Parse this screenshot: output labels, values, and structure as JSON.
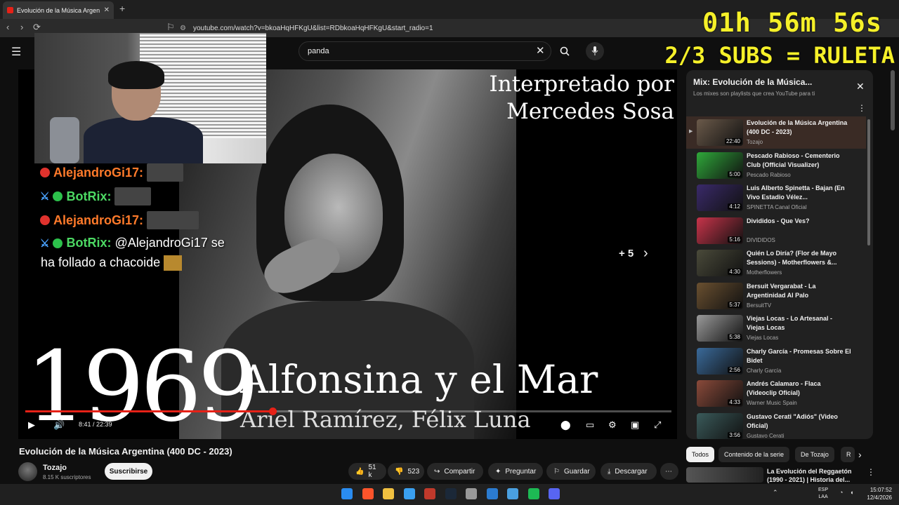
{
  "browser": {
    "tab_title": "Evolución de la Música Argen",
    "tab_close": "✕",
    "new_tab": "+",
    "url": "youtube.com/watch?v=bkoaHqHFKgU&list=RDbkoaHqHFKgU&start_radio=1"
  },
  "overlay": {
    "timer": "01h 56m 56s",
    "subs_text": "2/3 SUBS = RULETA"
  },
  "search": {
    "query": "panda",
    "clear": "✕"
  },
  "player": {
    "caption_line1": "Interpretado por",
    "caption_line2": "Mercedes Sosa",
    "year": "1969",
    "song_title": "Alfonsina y el Mar",
    "song_authors": "Ariel Ramírez, Félix Luna",
    "more_count": "+ 5",
    "timecode": "8:41 / 22:39",
    "progress_fraction": 0.383
  },
  "chat": [
    {
      "user": "AlejandroGi17:",
      "msg": ""
    },
    {
      "user": "BotRix:",
      "msg": ""
    },
    {
      "user": "AlejandroGi17:",
      "msg": ""
    },
    {
      "user": "BotRix:",
      "msg": "@AlejandroGi17 se"
    }
  ],
  "chat_continuation": "ha follado a chacoide",
  "video": {
    "title": "Evolución de la Música Argentina (400 DC - 2023)",
    "channel": "Tozajo",
    "subscribers": "8.15 K suscriptores",
    "subscribe": "Suscribirse",
    "likes": "51 k",
    "dislikes": "523",
    "share": "Compartir",
    "ask": "Preguntar",
    "save": "Guardar",
    "download": "Descargar"
  },
  "playlist": {
    "title": "Mix: Evolución de la Música...",
    "subtitle": "Los mixes son playlists que crea YouTube para ti",
    "items": [
      {
        "title": "Evolución de la Música Argentina (400 DC - 2023)",
        "channel": "Tozajo",
        "duration": "22:40",
        "color": "#6b5a4a"
      },
      {
        "title": "Pescado Rabioso - Cementerio Club (Official Visualizer)",
        "channel": "Pescado Rabioso",
        "duration": "5:00",
        "color": "#2fa83a"
      },
      {
        "title": "Luis Alberto Spinetta - Bajan (En Vivo Estadio Vélez...",
        "channel": "SPINETTA Canal Oficial",
        "duration": "4:12",
        "color": "#3a2a6a"
      },
      {
        "title": "Divididos - Que Ves?",
        "channel": "DIVIDIDOS",
        "duration": "5:16",
        "color": "#c8344a"
      },
      {
        "title": "Quién Lo Diría? (Flor de Mayo Sessions) - Motherflowers &...",
        "channel": "Motherflowers",
        "duration": "4:30",
        "color": "#4a4a3a"
      },
      {
        "title": "Bersuit Vergarabat - La Argentinidad Al Palo",
        "channel": "BersuitTV",
        "duration": "5:37",
        "color": "#6a5030"
      },
      {
        "title": "Viejas Locas - Lo Artesanal - Viejas Locas",
        "channel": "Viejas Locas",
        "duration": "5:38",
        "color": "#9a9a9a"
      },
      {
        "title": "Charly García - Promesas Sobre El Bidet",
        "channel": "Charly García",
        "duration": "2:56",
        "color": "#3a6a9a"
      },
      {
        "title": "Andrés Calamaro - Flaca (Videoclip Oficial)",
        "channel": "Warner Music Spain",
        "duration": "4:33",
        "color": "#8a4a3a"
      },
      {
        "title": "Gustavo Cerati \"Adiós\" (Video Oficial)",
        "channel": "Gustavo Cerati",
        "duration": "3:56",
        "color": "#3a5a5a"
      }
    ]
  },
  "chips": [
    "Todos",
    "Contenido de la serie",
    "De Tozajo",
    "R"
  ],
  "recommendation": {
    "title": "La Evolución del Reggaetón (1990 - 2021) | Historia del..."
  },
  "taskbar": {
    "lang1": "ESP",
    "lang2": "LAA",
    "time": "15:07:52",
    "date": "12/4/2026",
    "icons": [
      "windows-icon",
      "brave-icon",
      "folder-icon",
      "bing-icon",
      "calendar-icon",
      "steam-icon",
      "github-icon",
      "ccleaner-icon",
      "notepad-icon",
      "spotify-icon",
      "discord-icon"
    ],
    "icon_colors": [
      "#2a8cf0",
      "#fb542b",
      "#f0c040",
      "#3aa0f0",
      "#c0392b",
      "#1b2838",
      "#999999",
      "#2b7bd0",
      "#4aa0e0",
      "#1db954",
      "#5865f2"
    ]
  }
}
